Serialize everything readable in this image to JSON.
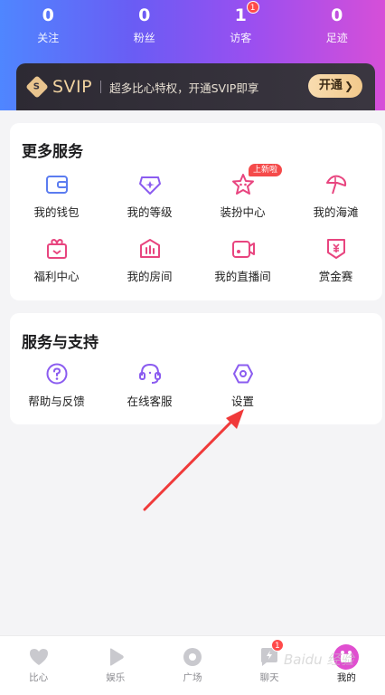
{
  "stats": [
    {
      "value": "0",
      "label": "关注"
    },
    {
      "value": "0",
      "label": "粉丝"
    },
    {
      "value": "1",
      "label": "访客",
      "badge": "1"
    },
    {
      "value": "0",
      "label": "足迹"
    }
  ],
  "svip": {
    "logo_text": "SVIP",
    "gem_letter": "S",
    "description": "超多比心特权，开通SVIP即享",
    "button_label": "开通",
    "button_arrow": "❯"
  },
  "more_services": {
    "title": "更多服务",
    "items": [
      {
        "label": "我的钱包",
        "icon": "wallet-icon"
      },
      {
        "label": "我的等级",
        "icon": "level-icon"
      },
      {
        "label": "装扮中心",
        "icon": "dress-up-icon",
        "badge": "上新啦"
      },
      {
        "label": "我的海滩",
        "icon": "beach-icon"
      },
      {
        "label": "福利中心",
        "icon": "gift-icon"
      },
      {
        "label": "我的房间",
        "icon": "room-icon"
      },
      {
        "label": "我的直播间",
        "icon": "live-camera-icon"
      },
      {
        "label": "赏金赛",
        "icon": "bounty-icon"
      }
    ]
  },
  "support": {
    "title": "服务与支持",
    "items": [
      {
        "label": "帮助与反馈",
        "icon": "help-icon"
      },
      {
        "label": "在线客服",
        "icon": "headset-icon"
      },
      {
        "label": "设置",
        "icon": "settings-icon"
      }
    ]
  },
  "bottom_nav": [
    {
      "label": "比心",
      "icon": "heart-icon"
    },
    {
      "label": "娱乐",
      "icon": "play-icon"
    },
    {
      "label": "广场",
      "icon": "plaza-icon"
    },
    {
      "label": "聊天",
      "icon": "chat-icon",
      "badge": "1"
    },
    {
      "label": "我的",
      "icon": "profile-icon",
      "active": true
    }
  ],
  "watermark": "Baidu 经验",
  "colors": {
    "blue_icon": "#5b7cf0",
    "purple_icon": "#8b5cf0",
    "pink_icon": "#e8457f",
    "svip_gold": "#f1d3a0",
    "badge_red": "#ff4a4a",
    "annotation_arrow": "#f03a3a"
  }
}
